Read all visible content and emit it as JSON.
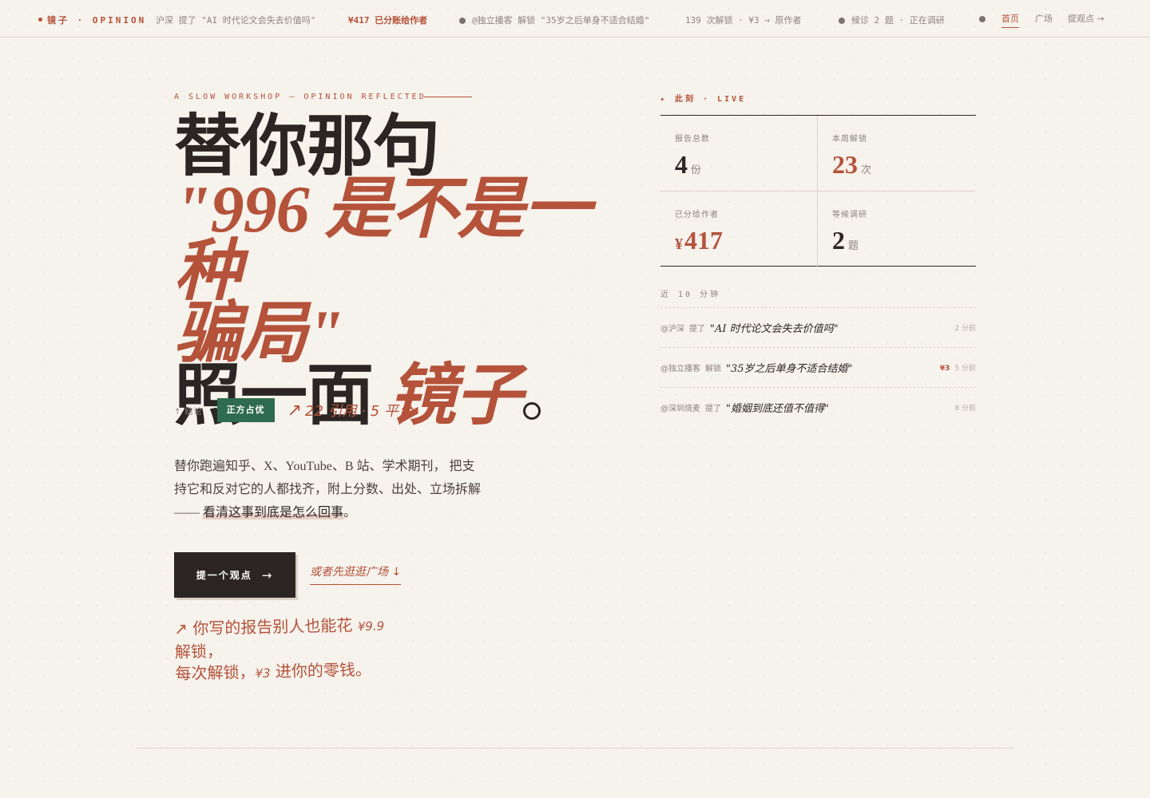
{
  "topbar": {
    "brand": "镜子 · OPINION",
    "ticker1_text": "沪深 提了 \"AI 时代论文会失去价值吗\"",
    "ticker1_amount": "¥417 已分账给作者",
    "ticker2_text": "@独立播客 解锁 \"35岁之后单身不适合结婚\"",
    "ticker3_text": "139 次解锁 · ¥3 → 原作者",
    "ticker4_text": "候诊 2 题 · 正在调研"
  },
  "nav": {
    "home": "首页",
    "square": "广场",
    "submit": "提观点 →"
  },
  "hero": {
    "kicker": "A SLOW WORKSHOP — OPINION REFLECTED",
    "line1": "替你那句",
    "line2": "\"996 是不是一种",
    "line3": "骗局\"",
    "line4_plain": "照一面 ",
    "line4_italic": "镜子",
    "line4_tail": "。",
    "verdict_label": "↑ 结论",
    "verdict_badge": "正方占优",
    "verdict_meta_arrow": "↗",
    "verdict_meta": "22 引用 · 5 平台",
    "desc_part1": "替你跑遍知乎、X、YouTube、B 站、学术期刊， 把支持它和反对它的人都找齐，附上分数、出处、立场拆解—— ",
    "desc_highlight": "看清这事到底是怎么回事",
    "desc_tail": "。",
    "cta_label": "提一个观点",
    "cta_arrow": "→",
    "secondary_link": "或者先逛逛广场 ↓",
    "note_arrow": "↗",
    "note_text1": " 你写的报告别人也能花 ",
    "note_price1": "¥9.9",
    "note_text2": " 解锁，",
    "note_text3": "每次解锁，",
    "note_price2": "¥3",
    "note_text4": " 进你的零钱。"
  },
  "live": {
    "label": "▸ 此刻 · LIVE",
    "stats": [
      {
        "label": "报告总数",
        "value": "4",
        "unit": "份",
        "prefix": ""
      },
      {
        "label": "本周解锁",
        "value": "23",
        "unit": "次",
        "prefix": ""
      },
      {
        "label": "已分给作者",
        "value": "417",
        "unit": "",
        "prefix": "¥"
      },
      {
        "label": "等候调研",
        "value": "2",
        "unit": "题",
        "prefix": ""
      }
    ],
    "recent_label": "近 10 分钟",
    "feed": [
      {
        "user": "@沪深",
        "action": "提了",
        "title": "\"AI 时代论文会失去价值吗\"",
        "price": "",
        "time": "2 分前"
      },
      {
        "user": "@独立播客",
        "action": "解锁",
        "title": "\"35岁之后单身不适合结婚\"",
        "price": "¥3",
        "time": "5 分前"
      },
      {
        "user": "@深圳烧麦",
        "action": "提了",
        "title": "\"婚姻到底还值不值得\"",
        "price": "",
        "time": "8 分前"
      }
    ]
  },
  "colors": {
    "accent": "#b4523a",
    "verdict_green": "#2f6b50",
    "ink": "#2b2623",
    "paper": "#f6f2ec"
  }
}
